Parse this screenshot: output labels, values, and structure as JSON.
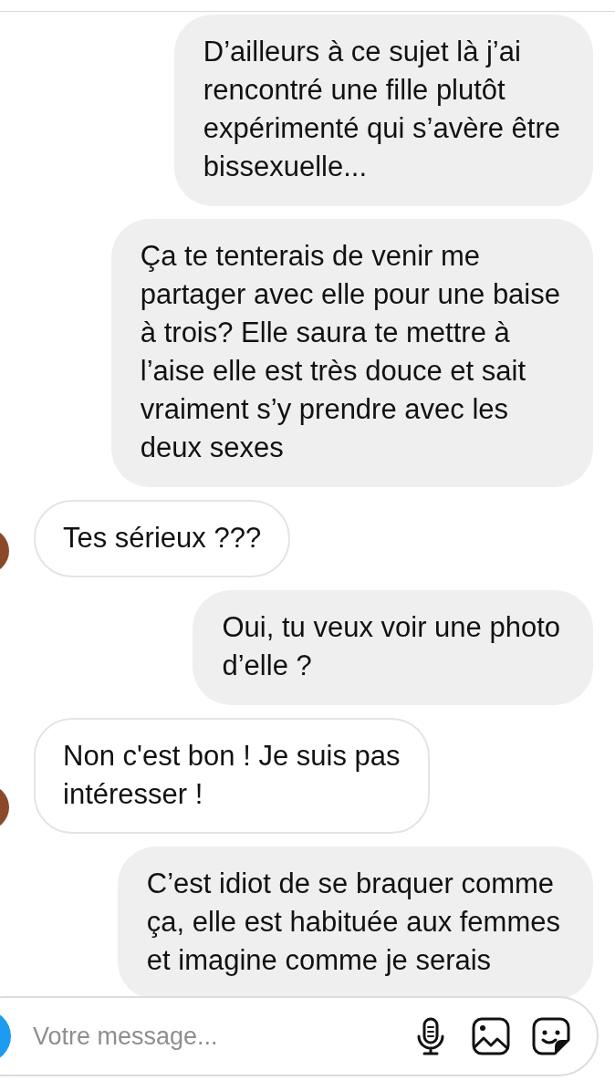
{
  "messages": [
    {
      "kind": "sent",
      "lines": [
        "D’ailleurs à ce sujet là j’ai",
        "rencontré une fille plutôt",
        "expérimenté qui s’avère être",
        "bissexuelle..."
      ]
    },
    {
      "kind": "sent",
      "lines": [
        "Ça te tenterais de venir me",
        "partager avec elle pour une baise",
        "à trois? Elle saura te mettre à",
        "l’aise elle est très douce et sait",
        "vraiment s’y prendre avec les",
        "deux sexes"
      ]
    },
    {
      "kind": "received",
      "lines": [
        "Tes sérieux ???"
      ]
    },
    {
      "kind": "sent",
      "lines": [
        "Oui, tu veux voir une photo",
        "d’elle ?"
      ]
    },
    {
      "kind": "received",
      "lines": [
        "Non c'est bon ! Je suis pas",
        "intéresser !"
      ]
    },
    {
      "kind": "sent",
      "lines": [
        "C’est idiot de se braquer comme",
        "ça, elle est habituée aux femmes",
        "et imagine comme je serais"
      ]
    }
  ],
  "composer": {
    "placeholder": "Votre message..."
  }
}
